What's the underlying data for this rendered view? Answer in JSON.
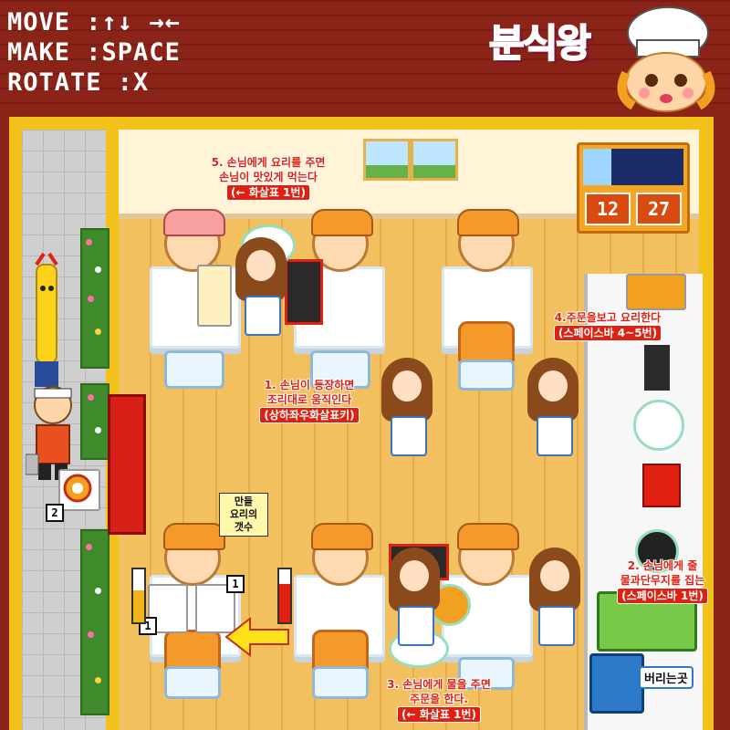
{
  "controls": {
    "move_label": "MOVE :",
    "move_keys": "↑↓ →←",
    "make_label": "MAKE :",
    "make_key": "SPACE",
    "rotate_label": "ROTATE :",
    "rotate_key": "X"
  },
  "logo": {
    "title": "분식왕"
  },
  "clock": {
    "hour": "12",
    "minute": "27"
  },
  "instructions": {
    "step1": {
      "line1": "1. 손님이 등장하면",
      "line2": "조리대로 움직인다",
      "hint": "(상하좌우화살표키)"
    },
    "step2": {
      "line1": "2. 손님에게 줄",
      "line2": "물과단무지를 집는",
      "hint": "(스페이스바 1번)"
    },
    "step3": {
      "line1": "3. 손님에게 물을 주면",
      "line2": "주문을 한다.",
      "hint": "(← 화살표 1번)"
    },
    "step4": {
      "line1": "4.주문을보고 요리한다",
      "hint": "(스페이스바 4~5번)"
    },
    "step5": {
      "line1": "5. 손님에게 요리를 주면",
      "line2": "손님이 맛있게 먹는다",
      "hint": "(← 화살표 1번)"
    },
    "dish_count": {
      "line1": "만들",
      "line2": "요리의",
      "line3": "갯수"
    }
  },
  "badges": {
    "waiting_customers": "2",
    "order_count_a": "1",
    "order_count_b": "1"
  },
  "trash": {
    "label": "버리는곳"
  },
  "colors": {
    "header_bg": "#8a2318",
    "frame": "#f2c21a",
    "floor": "#f3c060",
    "instruction_text": "#e02010",
    "logo": "#ff4a7c"
  }
}
